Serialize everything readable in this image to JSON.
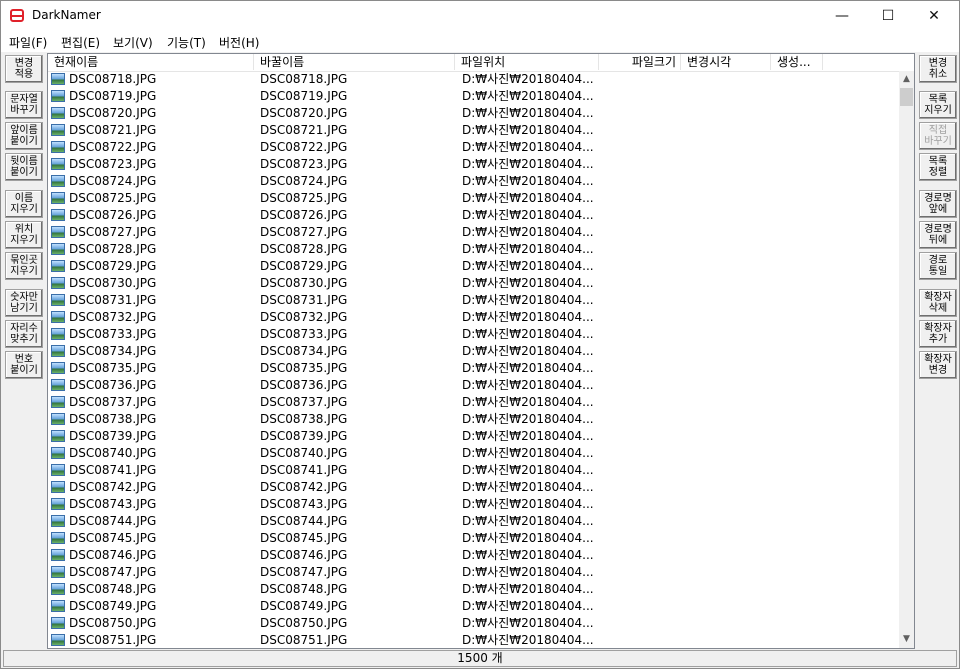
{
  "window": {
    "title": "DarkNamer"
  },
  "caption": {
    "minimize": "—",
    "maximize": "☐",
    "close": "✕"
  },
  "menu": [
    "파일(F)",
    "편집(E)",
    "보기(V)",
    "기능(T)",
    "버전(H)"
  ],
  "left_buttons": [
    {
      "label": "변경\n적용",
      "enabled": true
    },
    {
      "label": "문자열\n바꾸기",
      "enabled": true
    },
    {
      "label": "앞이름\n붙이기",
      "enabled": true
    },
    {
      "label": "뒷이름\n붙이기",
      "enabled": true
    },
    {
      "label": "이름\n지우기",
      "enabled": true
    },
    {
      "label": "위치\n지우기",
      "enabled": true
    },
    {
      "label": "묶인곳\n지우기",
      "enabled": true
    },
    {
      "label": "숫자만\n남기기",
      "enabled": true
    },
    {
      "label": "자리수\n맞추기",
      "enabled": true
    },
    {
      "label": "번호\n붙이기",
      "enabled": true
    }
  ],
  "right_buttons": [
    {
      "label": "변경\n취소",
      "enabled": true
    },
    {
      "label": "목록\n지우기",
      "enabled": true
    },
    {
      "label": "직접\n바꾸기",
      "enabled": false
    },
    {
      "label": "목록\n정렬",
      "enabled": true
    },
    {
      "label": "경로명\n앞에",
      "enabled": true
    },
    {
      "label": "경로명\n뒤에",
      "enabled": true
    },
    {
      "label": "경로\n통일",
      "enabled": true
    },
    {
      "label": "확장자\n삭제",
      "enabled": true
    },
    {
      "label": "확장자\n추가",
      "enabled": true
    },
    {
      "label": "확장자\n변경",
      "enabled": true
    }
  ],
  "columns": [
    "현재이름",
    "바꿀이름",
    "파일위치",
    "파일크기",
    "변경시각",
    "생성..."
  ],
  "rows": [
    {
      "current": "DSC08718.JPG",
      "new": "DSC08718.JPG",
      "path": "D:₩사진₩20180404..."
    },
    {
      "current": "DSC08719.JPG",
      "new": "DSC08719.JPG",
      "path": "D:₩사진₩20180404..."
    },
    {
      "current": "DSC08720.JPG",
      "new": "DSC08720.JPG",
      "path": "D:₩사진₩20180404..."
    },
    {
      "current": "DSC08721.JPG",
      "new": "DSC08721.JPG",
      "path": "D:₩사진₩20180404..."
    },
    {
      "current": "DSC08722.JPG",
      "new": "DSC08722.JPG",
      "path": "D:₩사진₩20180404..."
    },
    {
      "current": "DSC08723.JPG",
      "new": "DSC08723.JPG",
      "path": "D:₩사진₩20180404..."
    },
    {
      "current": "DSC08724.JPG",
      "new": "DSC08724.JPG",
      "path": "D:₩사진₩20180404..."
    },
    {
      "current": "DSC08725.JPG",
      "new": "DSC08725.JPG",
      "path": "D:₩사진₩20180404..."
    },
    {
      "current": "DSC08726.JPG",
      "new": "DSC08726.JPG",
      "path": "D:₩사진₩20180404..."
    },
    {
      "current": "DSC08727.JPG",
      "new": "DSC08727.JPG",
      "path": "D:₩사진₩20180404..."
    },
    {
      "current": "DSC08728.JPG",
      "new": "DSC08728.JPG",
      "path": "D:₩사진₩20180404..."
    },
    {
      "current": "DSC08729.JPG",
      "new": "DSC08729.JPG",
      "path": "D:₩사진₩20180404..."
    },
    {
      "current": "DSC08730.JPG",
      "new": "DSC08730.JPG",
      "path": "D:₩사진₩20180404..."
    },
    {
      "current": "DSC08731.JPG",
      "new": "DSC08731.JPG",
      "path": "D:₩사진₩20180404..."
    },
    {
      "current": "DSC08732.JPG",
      "new": "DSC08732.JPG",
      "path": "D:₩사진₩20180404..."
    },
    {
      "current": "DSC08733.JPG",
      "new": "DSC08733.JPG",
      "path": "D:₩사진₩20180404..."
    },
    {
      "current": "DSC08734.JPG",
      "new": "DSC08734.JPG",
      "path": "D:₩사진₩20180404..."
    },
    {
      "current": "DSC08735.JPG",
      "new": "DSC08735.JPG",
      "path": "D:₩사진₩20180404..."
    },
    {
      "current": "DSC08736.JPG",
      "new": "DSC08736.JPG",
      "path": "D:₩사진₩20180404..."
    },
    {
      "current": "DSC08737.JPG",
      "new": "DSC08737.JPG",
      "path": "D:₩사진₩20180404..."
    },
    {
      "current": "DSC08738.JPG",
      "new": "DSC08738.JPG",
      "path": "D:₩사진₩20180404..."
    },
    {
      "current": "DSC08739.JPG",
      "new": "DSC08739.JPG",
      "path": "D:₩사진₩20180404..."
    },
    {
      "current": "DSC08740.JPG",
      "new": "DSC08740.JPG",
      "path": "D:₩사진₩20180404..."
    },
    {
      "current": "DSC08741.JPG",
      "new": "DSC08741.JPG",
      "path": "D:₩사진₩20180404..."
    },
    {
      "current": "DSC08742.JPG",
      "new": "DSC08742.JPG",
      "path": "D:₩사진₩20180404..."
    },
    {
      "current": "DSC08743.JPG",
      "new": "DSC08743.JPG",
      "path": "D:₩사진₩20180404..."
    },
    {
      "current": "DSC08744.JPG",
      "new": "DSC08744.JPG",
      "path": "D:₩사진₩20180404..."
    },
    {
      "current": "DSC08745.JPG",
      "new": "DSC08745.JPG",
      "path": "D:₩사진₩20180404..."
    },
    {
      "current": "DSC08746.JPG",
      "new": "DSC08746.JPG",
      "path": "D:₩사진₩20180404..."
    },
    {
      "current": "DSC08747.JPG",
      "new": "DSC08747.JPG",
      "path": "D:₩사진₩20180404..."
    },
    {
      "current": "DSC08748.JPG",
      "new": "DSC08748.JPG",
      "path": "D:₩사진₩20180404..."
    },
    {
      "current": "DSC08749.JPG",
      "new": "DSC08749.JPG",
      "path": "D:₩사진₩20180404..."
    },
    {
      "current": "DSC08750.JPG",
      "new": "DSC08750.JPG",
      "path": "D:₩사진₩20180404..."
    },
    {
      "current": "DSC08751.JPG",
      "new": "DSC08751.JPG",
      "path": "D:₩사진₩20180404..."
    }
  ],
  "status": {
    "count_text": "1500 개"
  },
  "colors": {
    "title_icon": "#e0212a",
    "disabled_text": "#a0a0a0"
  }
}
